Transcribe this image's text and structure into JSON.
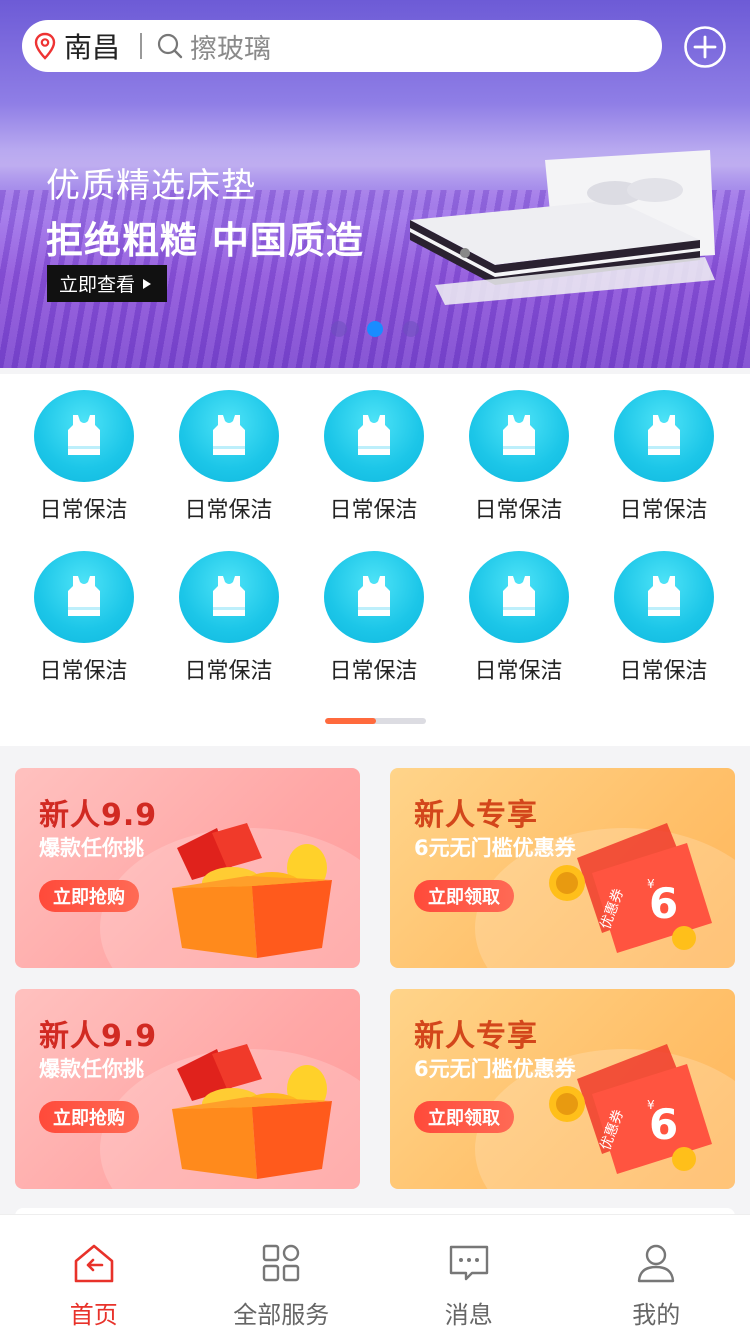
{
  "search": {
    "city": "南昌",
    "placeholder": "擦玻璃"
  },
  "banner": {
    "title": "优质精选床垫",
    "headline": "拒绝粗糙 中国质造",
    "button_label": "立即查看",
    "slide_count": 3,
    "active_slide": 2
  },
  "categories": [
    {
      "label": "日常保洁",
      "icon": "vest-icon"
    },
    {
      "label": "日常保洁",
      "icon": "vest-icon"
    },
    {
      "label": "日常保洁",
      "icon": "vest-icon"
    },
    {
      "label": "日常保洁",
      "icon": "vest-icon"
    },
    {
      "label": "日常保洁",
      "icon": "vest-icon"
    },
    {
      "label": "日常保洁",
      "icon": "vest-icon"
    },
    {
      "label": "日常保洁",
      "icon": "vest-icon"
    },
    {
      "label": "日常保洁",
      "icon": "vest-icon"
    },
    {
      "label": "日常保洁",
      "icon": "vest-icon"
    },
    {
      "label": "日常保洁",
      "icon": "vest-icon"
    }
  ],
  "category_pager": {
    "page": 1,
    "pages": 2
  },
  "promos": [
    {
      "title": "新人9.9",
      "subtitle": "爆款任你挑",
      "button": "立即抢购",
      "style": "red",
      "art": "gift-box-icon"
    },
    {
      "title": "新人专享",
      "subtitle": "6元无门槛优惠券",
      "button": "立即领取",
      "style": "orange",
      "art": "coupon-icon",
      "coupon_text": "优惠券",
      "coupon_value": "6",
      "coupon_currency": "¥"
    },
    {
      "title": "新人9.9",
      "subtitle": "爆款任你挑",
      "button": "立即抢购",
      "style": "red",
      "art": "gift-box-icon"
    },
    {
      "title": "新人专享",
      "subtitle": "6元无门槛优惠券",
      "button": "立即领取",
      "style": "orange",
      "art": "coupon-icon",
      "coupon_text": "优惠券",
      "coupon_value": "6",
      "coupon_currency": "¥"
    }
  ],
  "tabs": [
    {
      "label": "首页",
      "icon": "home-icon",
      "active": true
    },
    {
      "label": "全部服务",
      "icon": "grid-icon",
      "active": false
    },
    {
      "label": "消息",
      "icon": "message-icon",
      "active": false
    },
    {
      "label": "我的",
      "icon": "user-icon",
      "active": false
    }
  ],
  "colors": {
    "accent": "#e8322a",
    "category_icon": "#1cc6e8",
    "pager_active": "#ff6a3d",
    "dot_active": "#1a8cff"
  }
}
